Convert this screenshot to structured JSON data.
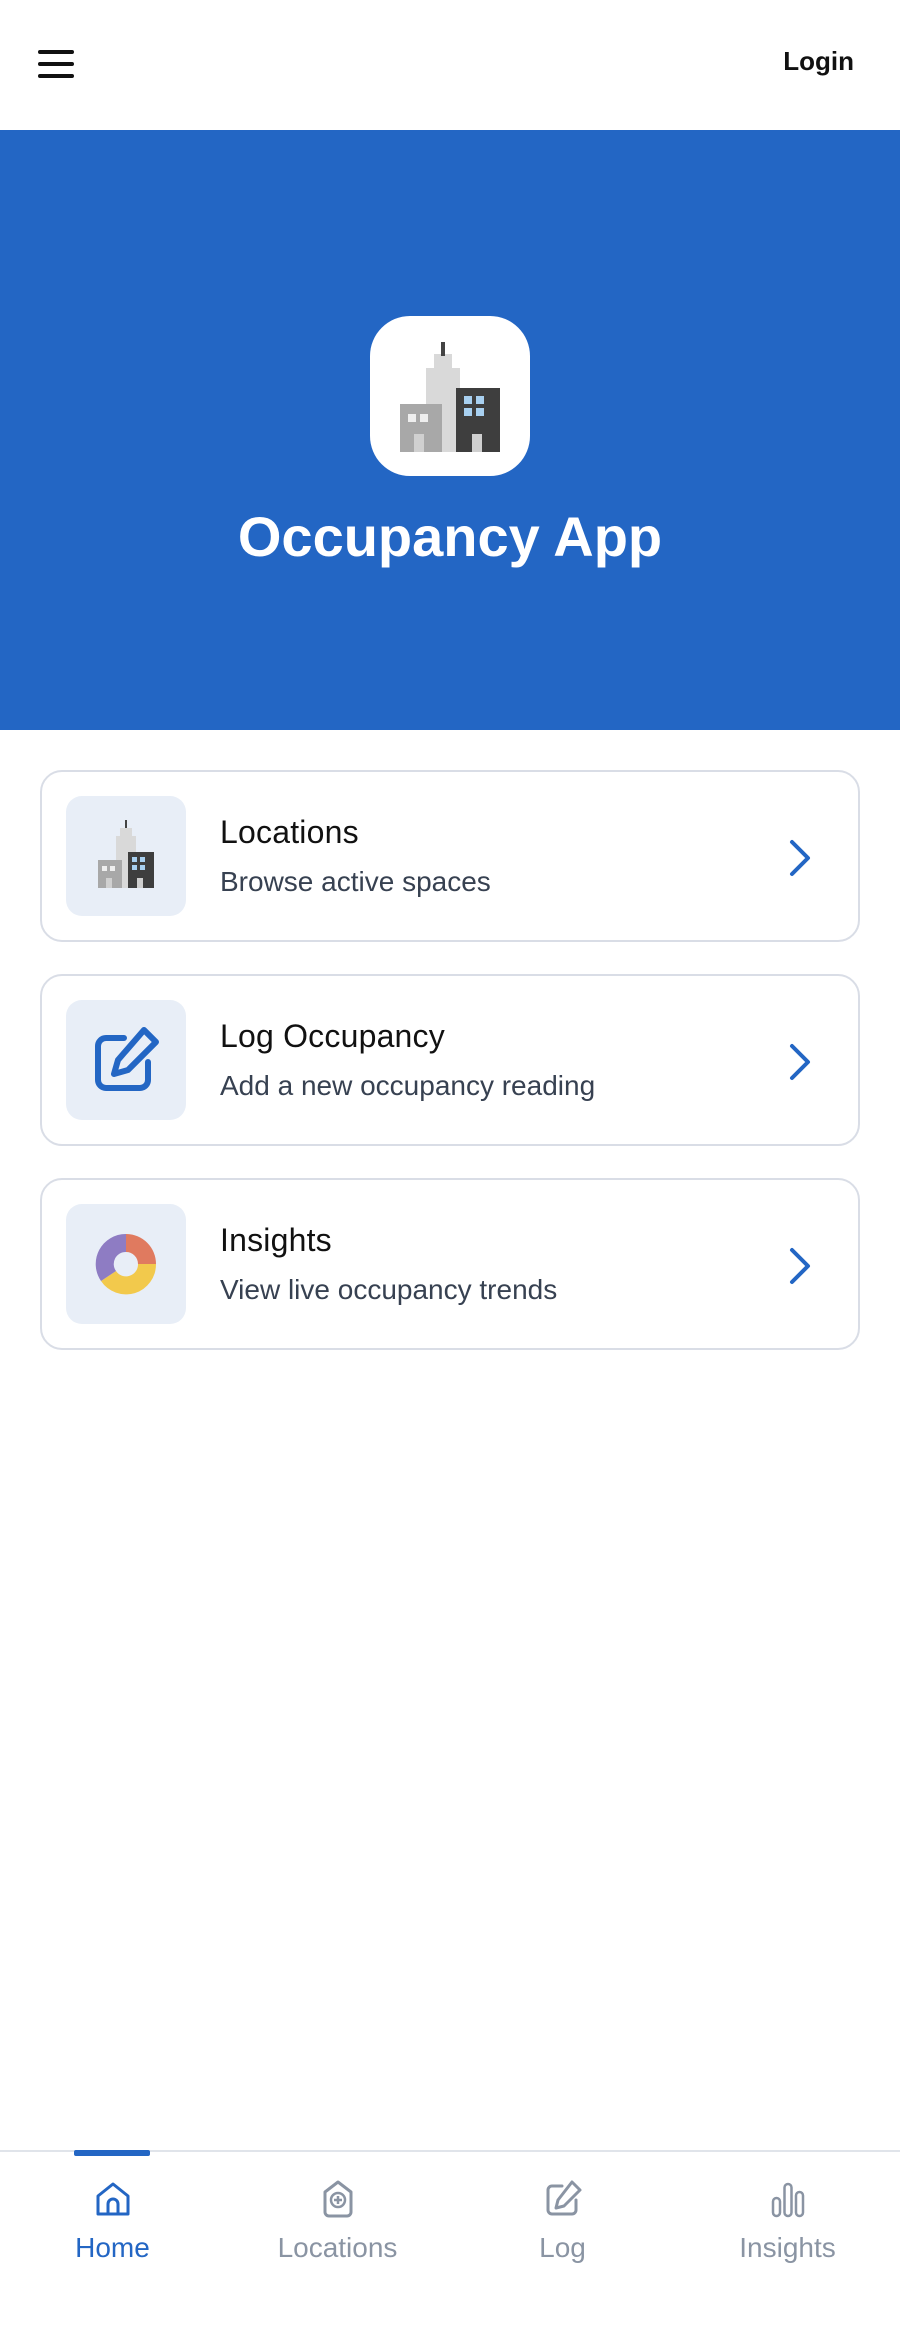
{
  "topbar": {
    "menu_icon": "hamburger-menu-icon",
    "login_label": "Login"
  },
  "hero": {
    "title": "Occupancy App",
    "icon": "city-buildings-icon",
    "background_color": "#2366c4"
  },
  "cards": [
    {
      "title": "Locations",
      "subtitle": "Browse active spaces",
      "icon": "city-buildings-icon"
    },
    {
      "title": "Log Occupancy",
      "subtitle": "Add a new occupancy reading",
      "icon": "edit-pencil-icon"
    },
    {
      "title": "Insights",
      "subtitle": "View live occupancy trends",
      "icon": "donut-chart-icon"
    }
  ],
  "bottom_nav": {
    "items": [
      {
        "label": "Home",
        "icon": "home-icon",
        "active": true
      },
      {
        "label": "Locations",
        "icon": "location-plus-icon",
        "active": false
      },
      {
        "label": "Log",
        "icon": "edit-pencil-icon",
        "active": false
      },
      {
        "label": "Insights",
        "icon": "bar-chart-icon",
        "active": false
      }
    ]
  },
  "colors": {
    "accent": "#2366c4",
    "card_border": "#d9dde6",
    "icon_tile": "#e8eef7",
    "inactive_nav": "#8a94a3"
  }
}
